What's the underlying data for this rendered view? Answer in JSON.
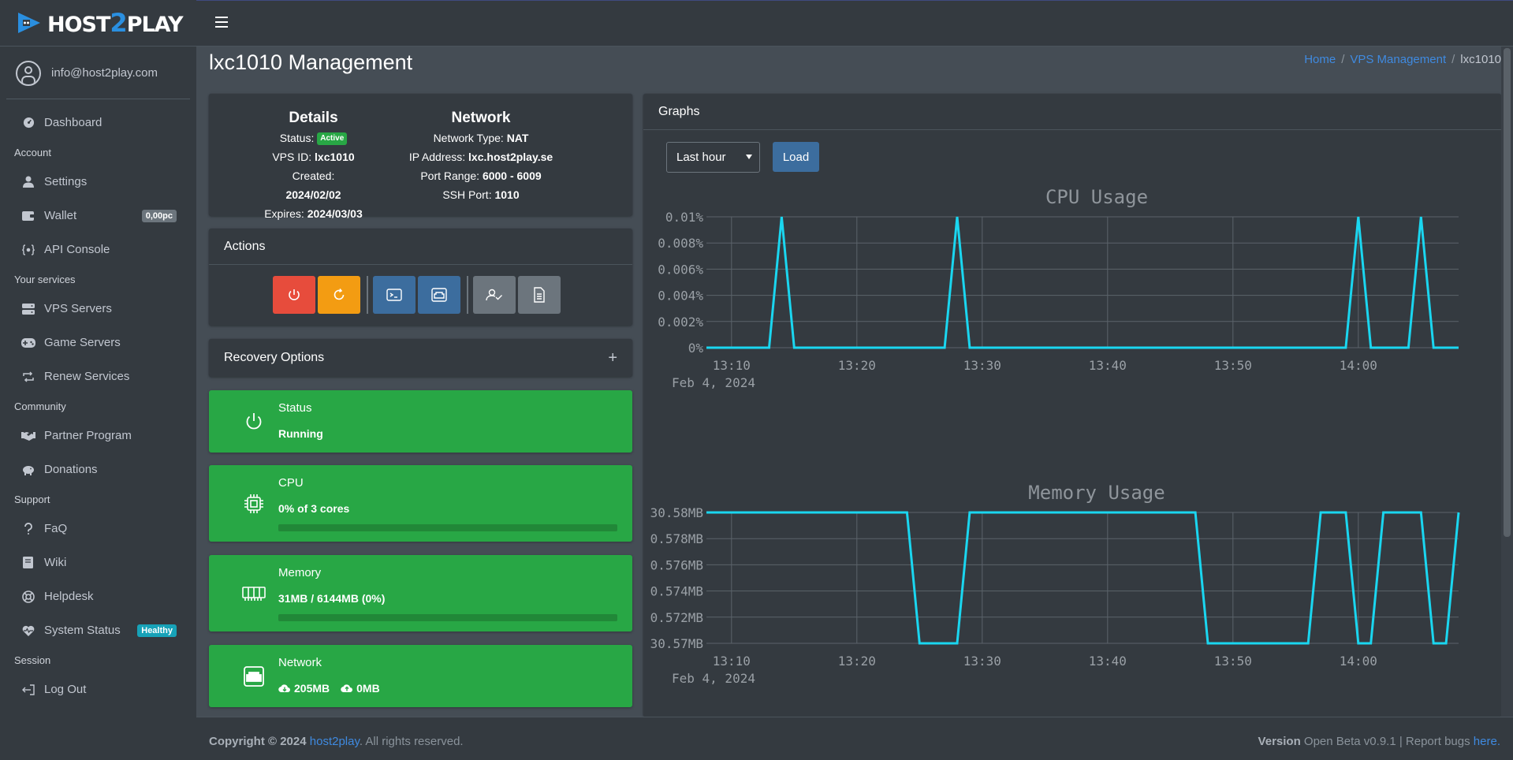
{
  "brand": {
    "name_a": "HOST",
    "name_b": "2",
    "name_c": "PLAY"
  },
  "user": {
    "email": "info@host2play.com"
  },
  "sidebar": {
    "items": [
      {
        "type": "item",
        "label": "Dashboard",
        "icon": "dashboard-icon"
      },
      {
        "type": "header",
        "label": "Account"
      },
      {
        "type": "item",
        "label": "Settings",
        "icon": "user-icon"
      },
      {
        "type": "item",
        "label": "Wallet",
        "icon": "wallet-icon",
        "badge": "0,00pc"
      },
      {
        "type": "item",
        "label": "API Console",
        "icon": "api-icon"
      },
      {
        "type": "header",
        "label": "Your services"
      },
      {
        "type": "item",
        "label": "VPS Servers",
        "icon": "server-icon"
      },
      {
        "type": "item",
        "label": "Game Servers",
        "icon": "gamepad-icon"
      },
      {
        "type": "item",
        "label": "Renew Services",
        "icon": "renew-icon"
      },
      {
        "type": "header",
        "label": "Community"
      },
      {
        "type": "item",
        "label": "Partner Program",
        "icon": "handshake-icon"
      },
      {
        "type": "item",
        "label": "Donations",
        "icon": "piggy-bank-icon"
      },
      {
        "type": "header",
        "label": "Support"
      },
      {
        "type": "item",
        "label": "FaQ",
        "icon": "question-icon"
      },
      {
        "type": "item",
        "label": "Wiki",
        "icon": "book-icon"
      },
      {
        "type": "item",
        "label": "Helpdesk",
        "icon": "lifebuoy-icon"
      },
      {
        "type": "item",
        "label": "System Status",
        "icon": "heartbeat-icon",
        "badge": "Healthy"
      },
      {
        "type": "header",
        "label": "Session"
      },
      {
        "type": "item",
        "label": "Log Out",
        "icon": "logout-icon"
      }
    ]
  },
  "page": {
    "title": "lxc1010 Management"
  },
  "breadcrumb": {
    "home": "Home",
    "vps": "VPS Management",
    "current": "lxc1010",
    "sep": "/"
  },
  "details": {
    "heading": "Details",
    "status_label": "Status:",
    "status_value": "Active",
    "vps_id_label": "VPS ID:",
    "vps_id_value": "lxc1010",
    "created_label": "Created:",
    "created_value": "2024/02/02",
    "expires_label": "Expires:",
    "expires_value": "2024/03/03"
  },
  "network": {
    "heading": "Network",
    "type_label": "Network Type:",
    "type_value": "NAT",
    "ip_label": "IP Address:",
    "ip_value": "lxc.host2play.se",
    "port_label": "Port Range:",
    "port_value": "6000 - 6009",
    "ssh_label": "SSH Port:",
    "ssh_value": "1010"
  },
  "actions": {
    "title": "Actions"
  },
  "recovery": {
    "title": "Recovery Options",
    "toggle": "+"
  },
  "status_box": {
    "title": "Status",
    "value": "Running"
  },
  "cpu_box": {
    "title": "CPU",
    "value": "0% of 3 cores",
    "fraction": 0
  },
  "memory_box": {
    "title": "Memory",
    "value": "31MB / 6144MB (0%)",
    "fraction": 0
  },
  "network_box": {
    "title": "Network",
    "rx": "205MB",
    "tx": "0MB"
  },
  "graphs": {
    "title": "Graphs",
    "range_selected": "Last hour",
    "load_label": "Load"
  },
  "colors": {
    "series": "#1ad6f0",
    "success": "#28a745",
    "link": "#3f8ae0"
  },
  "chart_data": [
    {
      "type": "line",
      "title": "CPU Usage",
      "x": [
        "13:08",
        "13:09",
        "13:10",
        "13:11",
        "13:12",
        "13:13",
        "13:14",
        "13:15",
        "13:16",
        "13:17",
        "13:18",
        "13:19",
        "13:20",
        "13:21",
        "13:22",
        "13:23",
        "13:24",
        "13:25",
        "13:26",
        "13:27",
        "13:28",
        "13:29",
        "13:30",
        "13:31",
        "13:32",
        "13:33",
        "13:34",
        "13:35",
        "13:36",
        "13:37",
        "13:38",
        "13:39",
        "13:40",
        "13:41",
        "13:42",
        "13:43",
        "13:44",
        "13:45",
        "13:46",
        "13:47",
        "13:48",
        "13:49",
        "13:50",
        "13:51",
        "13:52",
        "13:53",
        "13:54",
        "13:55",
        "13:56",
        "13:57",
        "13:58",
        "13:59",
        "14:00",
        "14:01",
        "14:02",
        "14:03",
        "14:04",
        "14:05",
        "14:06",
        "14:07",
        "14:08"
      ],
      "series": [
        {
          "values": [
            0,
            0,
            0,
            0,
            0,
            0,
            0.01,
            0,
            0,
            0,
            0,
            0,
            0,
            0,
            0,
            0,
            0,
            0,
            0,
            0,
            0.01,
            0,
            0,
            0,
            0,
            0,
            0,
            0,
            0,
            0,
            0,
            0,
            0,
            0,
            0,
            0,
            0,
            0,
            0,
            0,
            0,
            0,
            0,
            0,
            0,
            0,
            0,
            0,
            0,
            0,
            0,
            0,
            0.01,
            0,
            0,
            0,
            0,
            0.01,
            0,
            0,
            0
          ]
        }
      ],
      "x_ticks": [
        "13:10",
        "13:20",
        "13:30",
        "13:40",
        "13:50",
        "14:00"
      ],
      "x_sublabel": "Feb 4, 2024",
      "y_ticks": [
        "0%",
        "0.002%",
        "0.004%",
        "0.006%",
        "0.008%",
        "0.01%"
      ],
      "ylim": [
        0,
        0.01
      ],
      "grid": true
    },
    {
      "type": "line",
      "title": "Memory Usage",
      "x": [
        "13:08",
        "13:09",
        "13:10",
        "13:11",
        "13:12",
        "13:13",
        "13:14",
        "13:15",
        "13:16",
        "13:17",
        "13:18",
        "13:19",
        "13:20",
        "13:21",
        "13:22",
        "13:23",
        "13:24",
        "13:25",
        "13:26",
        "13:27",
        "13:28",
        "13:29",
        "13:30",
        "13:31",
        "13:32",
        "13:33",
        "13:34",
        "13:35",
        "13:36",
        "13:37",
        "13:38",
        "13:39",
        "13:40",
        "13:41",
        "13:42",
        "13:43",
        "13:44",
        "13:45",
        "13:46",
        "13:47",
        "13:48",
        "13:49",
        "13:50",
        "13:51",
        "13:52",
        "13:53",
        "13:54",
        "13:55",
        "13:56",
        "13:57",
        "13:58",
        "13:59",
        "14:00",
        "14:01",
        "14:02",
        "14:03",
        "14:04",
        "14:05",
        "14:06",
        "14:07",
        "14:08"
      ],
      "series": [
        {
          "values": [
            30.58,
            30.58,
            30.58,
            30.58,
            30.58,
            30.58,
            30.58,
            30.58,
            30.58,
            30.58,
            30.58,
            30.58,
            30.58,
            30.58,
            30.58,
            30.58,
            30.58,
            30.57,
            30.57,
            30.57,
            30.57,
            30.58,
            30.58,
            30.58,
            30.58,
            30.58,
            30.58,
            30.58,
            30.58,
            30.58,
            30.58,
            30.58,
            30.58,
            30.58,
            30.58,
            30.58,
            30.58,
            30.58,
            30.58,
            30.58,
            30.57,
            30.57,
            30.57,
            30.57,
            30.57,
            30.57,
            30.57,
            30.57,
            30.57,
            30.58,
            30.58,
            30.58,
            30.57,
            30.57,
            30.58,
            30.58,
            30.58,
            30.58,
            30.57,
            30.57,
            30.58
          ]
        }
      ],
      "x_ticks": [
        "13:10",
        "13:20",
        "13:30",
        "13:40",
        "13:50",
        "14:00"
      ],
      "x_sublabel": "Feb 4, 2024",
      "y_ticks": [
        "30.57MB",
        "0.572MB",
        "0.574MB",
        "0.576MB",
        "0.578MB",
        "30.58MB"
      ],
      "ylim": [
        30.57,
        30.58
      ],
      "grid": true
    }
  ],
  "footer": {
    "copyright_bold": "Copyright © 2024",
    "brand_link": "host2play",
    "rights": ". All rights reserved.",
    "version_label": "Version",
    "version_text": "Open Beta v0.9.1 | Report bugs",
    "bugs_link": "here."
  }
}
